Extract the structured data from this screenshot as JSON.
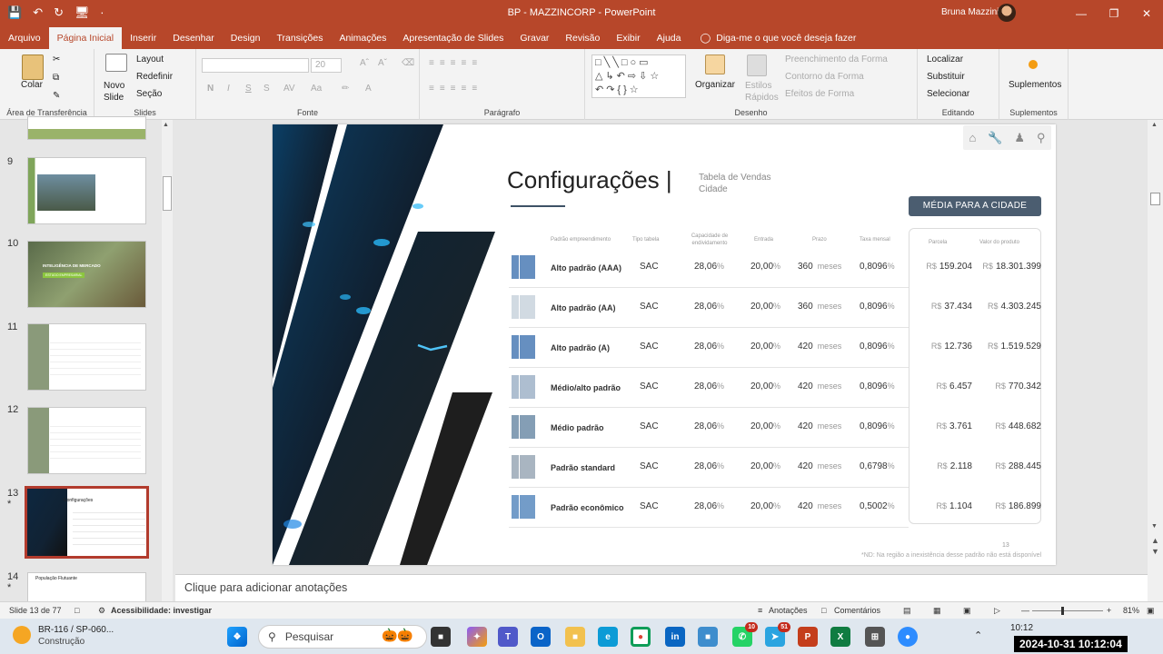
{
  "window": {
    "title": "BP - MAZZINCORP  -  PowerPoint",
    "user": "Bruna Mazzini",
    "controls": [
      "—",
      "❐",
      "✕"
    ]
  },
  "qat": [
    "💾",
    "↶",
    "↻",
    "🖥",
    "∙"
  ],
  "tabs": [
    "Arquivo",
    "Página Inicial",
    "Inserir",
    "Desenhar",
    "Design",
    "Transições",
    "Animações",
    "Apresentação de Slides",
    "Gravar",
    "Revisão",
    "Exibir",
    "Ajuda"
  ],
  "active_tab": "Página Inicial",
  "tell_me": "Diga-me o que você deseja fazer",
  "ribbon": {
    "clipboard": {
      "paste": "Colar",
      "label": "Área de Transferência"
    },
    "slides": {
      "new_slide": "Novo Slide",
      "layout": "Layout",
      "reset": "Redefinir",
      "section": "Seção",
      "label": "Slides"
    },
    "font": {
      "size": "20",
      "label": "Fonte",
      "styles": [
        "N",
        "I",
        "S",
        "S",
        "AV",
        "Aa",
        "A"
      ]
    },
    "paragraph": {
      "label": "Parágrafo"
    },
    "drawing": {
      "arrange": "Organizar",
      "quick_styles": "Estilos Rápidos",
      "fill": "Preenchimento da Forma",
      "outline": "Contorno da Forma",
      "effects": "Efeitos de Forma",
      "label": "Desenho"
    },
    "editing": {
      "find": "Localizar",
      "replace": "Substituir",
      "select": "Selecionar",
      "label": "Editando"
    },
    "addins": {
      "button": "Suplementos",
      "label": "Suplementos"
    }
  },
  "thumbnails": [
    {
      "num": "9",
      "star": ""
    },
    {
      "num": "10",
      "star": ""
    },
    {
      "num": "11",
      "star": ""
    },
    {
      "num": "12",
      "star": ""
    },
    {
      "num": "13",
      "star": "*"
    },
    {
      "num": "14",
      "star": "*"
    }
  ],
  "thumb_texts": {
    "t10": "INTELIGÊNCIA DE MERCADO",
    "t10b": "ESTUDO EMPRESARIAL",
    "t13": "Configurações",
    "t14": "População Flutuante"
  },
  "slide": {
    "title": "Configurações",
    "separator": "|",
    "subtitle": "Tabela de Vendas Cidade",
    "button": "MÉDIA PARA A CIDADE",
    "headers": [
      "Padrão empreendimento",
      "Tipo tabela",
      "Capacidade de endividamento",
      "Entrada",
      "Prazo",
      "Taxa mensal",
      "Parcela",
      "Valor do produto"
    ],
    "rows": [
      {
        "padrao": "Alto padrão (AAA)",
        "tipo": "SAC",
        "cap": "28,06",
        "entrada": "20,00",
        "prazo": "360",
        "taxa": "0,8096",
        "parcela": "159.204",
        "valor": "18.301.399"
      },
      {
        "padrao": "Alto padrão (AA)",
        "tipo": "SAC",
        "cap": "28,06",
        "entrada": "20,00",
        "prazo": "360",
        "taxa": "0,8096",
        "parcela": "37.434",
        "valor": "4.303.245"
      },
      {
        "padrao": "Alto padrão (A)",
        "tipo": "SAC",
        "cap": "28,06",
        "entrada": "20,00",
        "prazo": "420",
        "taxa": "0,8096",
        "parcela": "12.736",
        "valor": "1.519.529"
      },
      {
        "padrao": "Médio/alto padrão",
        "tipo": "SAC",
        "cap": "28,06",
        "entrada": "20,00",
        "prazo": "420",
        "taxa": "0,8096",
        "parcela": "6.457",
        "valor": "770.342"
      },
      {
        "padrao": "Médio padrão",
        "tipo": "SAC",
        "cap": "28,06",
        "entrada": "20,00",
        "prazo": "420",
        "taxa": "0,8096",
        "parcela": "3.761",
        "valor": "448.682"
      },
      {
        "padrao": "Padrão standard",
        "tipo": "SAC",
        "cap": "28,06",
        "entrada": "20,00",
        "prazo": "420",
        "taxa": "0,6798",
        "parcela": "2.118",
        "valor": "288.445"
      },
      {
        "padrao": "Padrão econômico",
        "tipo": "SAC",
        "cap": "28,06",
        "entrada": "20,00",
        "prazo": "420",
        "taxa": "0,5002",
        "parcela": "1.104",
        "valor": "186.899"
      }
    ],
    "pct_unit": "%",
    "months_unit": "meses",
    "currency": "R$",
    "page_number": "13",
    "footnote": "*ND: Na região a inexistência desse padrão não está disponível"
  },
  "notes_placeholder": "Clique para adicionar anotações",
  "status": {
    "slide": "Slide 13 de 77",
    "accessibility": "Acessibilidade: investigar",
    "notes": "Anotações",
    "comments": "Comentários",
    "zoom": "81%",
    "zoom_fraction": 0.81
  },
  "taskbar": {
    "weather_title": "BR-116 / SP-060...",
    "weather_sub": "Construção",
    "search": "Pesquisar",
    "time": "10:12",
    "date": "2024-10-31",
    "timestamp": "2024-10-31  10:12:04",
    "badge_whatsapp": "10",
    "badge_telegram": "51"
  },
  "colors": {
    "accent": "#b7472a",
    "slide_button": "#4b5d70",
    "selection": "#b23b2d"
  }
}
